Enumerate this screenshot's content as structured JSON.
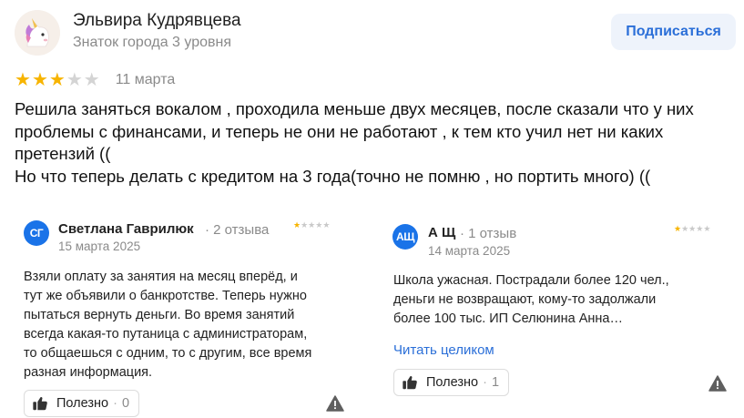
{
  "main_review": {
    "author_name": "Эльвира Кудрявцева",
    "author_level": "Знаток города 3 уровня",
    "subscribe_label": "Подписаться",
    "rating": 3,
    "date": "11 марта",
    "text_lines": [
      "Решила заняться вокалом , проходила меньше двух месяцев, после сказали что у них",
      "проблемы с финансами, и теперь не они не работают , к тем кто учил нет ни каких",
      "претензий ((",
      "Но что теперь делать с кредитом на 3 года(точно не помню , но портить много) (("
    ]
  },
  "related_reviews": [
    {
      "avatar_initials": "СГ",
      "author_name": "Светлана Гаврилюк",
      "review_count": "· 2 отзыва",
      "date": "15 марта 2025",
      "rating": 1,
      "text_lines": [
        "Взяли оплату за занятия на месяц вперёд, и",
        "тут же объявили о банкротстве. Теперь нужно",
        "пытаться вернуть деньги. Во время занятий",
        "всегда какая-то путаница с администраторам,",
        "то общаешься с одним, то с другим, все время",
        "разная информация."
      ],
      "useful_label": "Полезно",
      "useful_count": "0"
    },
    {
      "avatar_initials": "АЩ",
      "author_name": "А Щ",
      "review_count": "· 1 отзыв",
      "date": "14 марта 2025",
      "rating": 1,
      "text_lines": [
        "Школа ужасная. Пострадали более 120 чел.,",
        "деньги не возвращают, кому-то задолжали",
        "более 100 тыс. ИП Селюнина Анна…"
      ],
      "read_more": "Читать целиком",
      "useful_label": "Полезно",
      "useful_count": "1"
    }
  ],
  "colors": {
    "accent_blue": "#2b6fd8",
    "star_gold": "#f7b400",
    "avatar_blue": "#1a73e8"
  }
}
